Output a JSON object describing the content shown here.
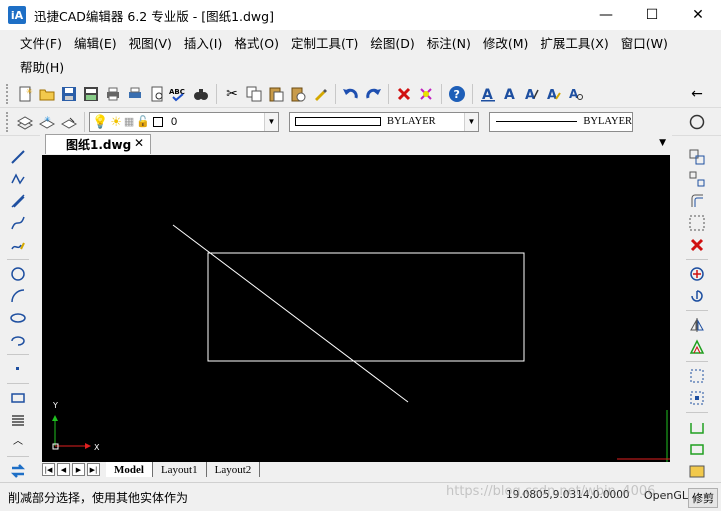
{
  "window": {
    "icon_text": "iA",
    "title": "迅捷CAD编辑器 6.2 专业版  - [图纸1.dwg]",
    "minimize": "—",
    "maximize": "☐",
    "close": "✕"
  },
  "menu": {
    "row1": [
      "文件(F)",
      "编辑(E)",
      "视图(V)",
      "插入(I)",
      "格式(O)",
      "定制工具(T)",
      "绘图(D)",
      "标注(N)",
      "修改(M)",
      "扩展工具(X)",
      "窗口(W)"
    ],
    "row2": [
      "帮助(H)"
    ]
  },
  "toolbar1": {
    "icons": [
      "new-icon",
      "open-icon",
      "save-icon",
      "save-as-icon",
      "print-icon",
      "print-preview-icon",
      "plot-icon",
      "spellcheck-icon",
      "find-icon",
      "cut-icon",
      "copy-icon",
      "paste-icon",
      "paste-special-icon",
      "match-properties-icon",
      "undo-icon",
      "redo-icon",
      "delete-icon",
      "purge-icon",
      "help-icon",
      "text-icon",
      "mtext-icon",
      "edit-text-icon",
      "style-text-icon",
      "find-text-icon",
      "arrow-left-icon"
    ],
    "spellcheck_label": "ABC"
  },
  "toolbar2": {
    "layer_name": "0",
    "linetype": "BYLAYER",
    "lineweight": "BYLAYER"
  },
  "document": {
    "tab_label": "图纸1.dwg",
    "tab_close": "✕"
  },
  "canvas": {
    "background": "#000000",
    "ucs_x": "X",
    "ucs_y": "Y"
  },
  "layouts": {
    "tabs": [
      "Model",
      "Layout1",
      "Layout2"
    ],
    "active": "Model"
  },
  "status": {
    "prompt": "削减部分选择，使用其他实体作为",
    "coords": "19.0805,9.0314,0.0000",
    "mode": "OpenGL",
    "button": "修剪",
    "watermark": "https://blog.csdn.net/wbin_4006..."
  },
  "colors": {
    "canvas_bg": "#000000",
    "app_icon": "#1e6fc6",
    "ucs_x": "#e02020",
    "ucs_y": "#20c020"
  }
}
